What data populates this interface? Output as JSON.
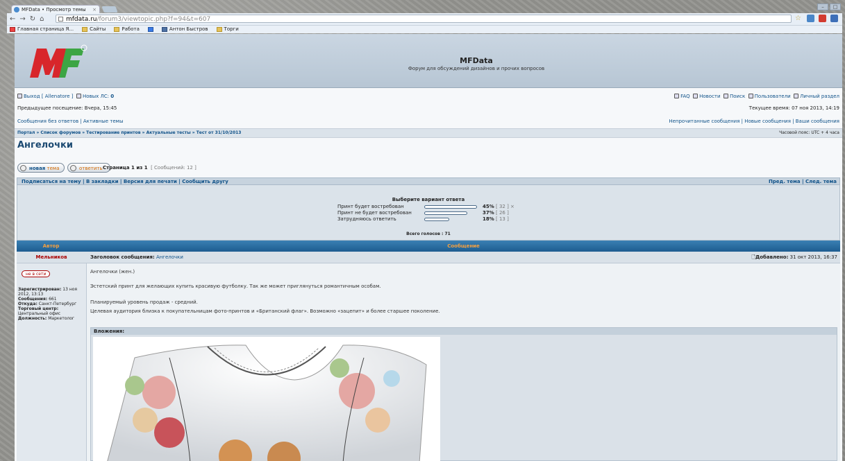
{
  "browser": {
    "tab_title": "MFData • Просмотр темы",
    "tab_close": "×",
    "url_host": "mfdata.ru",
    "url_path": "/forum3/viewtopic.php?f=94&t=607",
    "bookmarks": [
      "Главная страница Я...",
      "Сайты",
      "Работа",
      "",
      "Антон Быстров",
      "Торги"
    ]
  },
  "site": {
    "name": "MFData",
    "description": "Форум для обсуждений дизайнов и прочих вопросов"
  },
  "userbar": {
    "logout": "Выход [ Allenatore ]",
    "new_pm_label": "Новых ЛС:",
    "new_pm_count": "0",
    "links_right": [
      "FAQ",
      "Новости",
      "Поиск",
      "Пользователи",
      "Личный раздел"
    ],
    "last_visit": "Предыдущее посещение: Вчера, 15:45",
    "current_time": "Текущее время: 07 ноя 2013, 14:19",
    "unanswered": "Сообщения без ответов | Активные темы",
    "right_links": "Непрочитанные сообщения | Новые сообщения | Ваши сообщения"
  },
  "breadcrumb": {
    "path": "Портал » Список форумов » Тестирование принтов » Актуальные тесты » Тест от 31/10/2013",
    "timezone": "Часовой пояс: UTC + 4 часа"
  },
  "topic": {
    "title": "Ангелочки"
  },
  "buttons": {
    "new_topic_1": "новая",
    "new_topic_2": "тема",
    "reply": "ответить"
  },
  "pagination": {
    "page": "Страница 1 из 1",
    "messages": "[ Сообщений: 12 ]"
  },
  "actions": {
    "left": "Подписаться на тему | В закладки | Версия для печати | Сообщить другу",
    "right": "Пред. тема | След. тема"
  },
  "poll": {
    "question": "Выберите вариант ответа",
    "options": [
      {
        "label": "Принт будет востребован",
        "percent": 45,
        "pct_text": "45%",
        "votes": "[ 32 ] ×"
      },
      {
        "label": "Принт не будет востребован",
        "percent": 37,
        "pct_text": "37%",
        "votes": "[ 26 ]"
      },
      {
        "label": "Затрудняюсь ответить",
        "percent": 18,
        "pct_text": "18%",
        "votes": "[ 13 ]"
      }
    ],
    "total": "Всего голосов : 71"
  },
  "table": {
    "col_author": "Автор",
    "col_message": "Сообщение"
  },
  "post": {
    "author": "Мельников",
    "subject_label": "Заголовок сообщения:",
    "subject": "Ангелочки",
    "posted_label": "Добавлено:",
    "posted": "31 окт 2013, 16:37",
    "status": "не в сети",
    "profile": {
      "registered_label": "Зарегистрирован:",
      "registered": "13 ноя 2012, 13:13",
      "messages_label": "Сообщения:",
      "messages": "661",
      "from_label": "Откуда:",
      "from": "Санкт-Петербург",
      "center_label": "Торговый центр:",
      "center": "Центральный офис",
      "position_label": "Должность:",
      "position": "Маркетолог"
    },
    "lines": [
      "Ангелочки (жен.)",
      "Эстетский принт для желающих купить красивую футболку. Так же может приглянуться романтичным особам.",
      "Планируемый уровень продаж - средний.",
      "Целевая аудитория близка к покупательницам фото-принтов и «Британский флаг». Возможно «зацепит» и более старшее поколение."
    ],
    "attachments_label": "Вложения:"
  },
  "colors": {
    "header_bar": "#1d5d90",
    "link": "#105289",
    "author": "#a00000",
    "accent_orange": "#f5a040"
  }
}
